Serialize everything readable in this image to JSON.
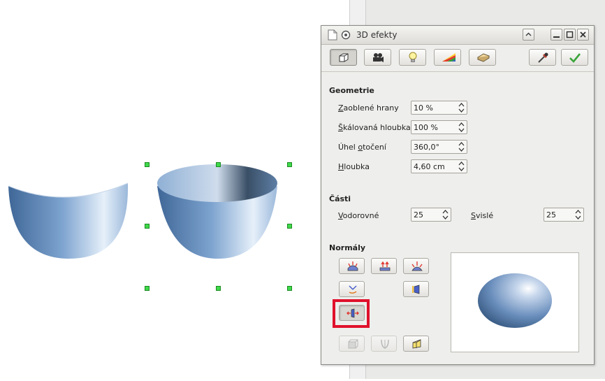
{
  "dialog": {
    "title": "3D efekty",
    "toolbar": [
      {
        "name": "geometry",
        "icon": "cube-icon",
        "active": true
      },
      {
        "name": "shading",
        "icon": "camera-icon",
        "active": false
      },
      {
        "name": "illumination",
        "icon": "bulb-icon",
        "active": false
      },
      {
        "name": "textures",
        "icon": "rainbow-icon",
        "active": false
      },
      {
        "name": "material",
        "icon": "material-icon",
        "active": false
      }
    ],
    "geometry": {
      "heading": "Geometrie",
      "rounded_edges": {
        "label_ul": "Z",
        "label_rest": "aoblené hrany",
        "value": "10 %"
      },
      "scaled_depth": {
        "label_ul": "Š",
        "label_rest": "kálovaná hloubka",
        "value": "100 %"
      },
      "rotation_angle": {
        "label_pre": "Úhel ",
        "label_ul": "o",
        "label_rest": "točení",
        "value": "360,0°"
      },
      "depth": {
        "label_ul": "H",
        "label_rest": "loubka",
        "value": "4,60 cm"
      }
    },
    "segments": {
      "heading": "Části",
      "horizontal": {
        "label_ul": "V",
        "label_rest": "odorovné",
        "value": "25"
      },
      "vertical": {
        "label_ul": "S",
        "label_rest": "vislé",
        "value": "25"
      }
    },
    "normals": {
      "heading": "Normály"
    }
  },
  "colors": {
    "handle": "#3fd94a",
    "highlight": "#e0112c",
    "bowl": "#6f95c4"
  }
}
